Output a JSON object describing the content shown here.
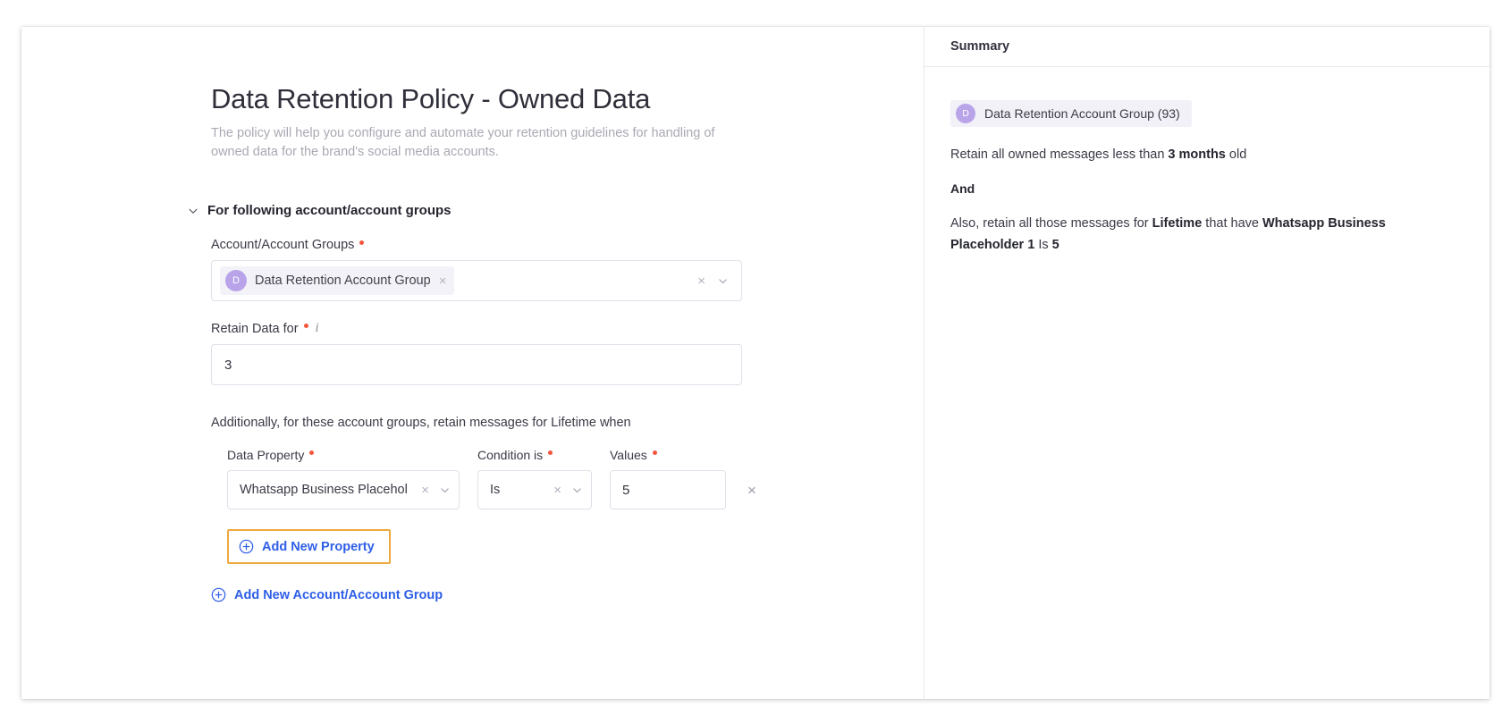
{
  "header": {
    "title": "Data Retention Policy - Owned Data",
    "subtitle": "The policy will help you configure and automate your retention guidelines for handling of owned data for the brand's social media accounts."
  },
  "section": {
    "title": "For following account/account groups",
    "collapse_icon": "chevron-down-icon"
  },
  "account_groups_field": {
    "label": "Account/Account Groups",
    "required_marker": "•",
    "chip": {
      "avatar_initial": "D",
      "avatar_color": "#b9a4ea",
      "text": "Data Retention Account Group",
      "remove_icon": "×"
    },
    "clear_icon": "×",
    "dropdown_icon": "chevron-down-icon"
  },
  "retain_data_field": {
    "label": "Retain Data for",
    "required_marker": "•",
    "info_icon": "i",
    "value": "3",
    "placeholder": "Enter duration"
  },
  "additional_text": "Additionally, for these account groups, retain messages for Lifetime when",
  "property_table": {
    "columns": [
      {
        "label": "Data Property",
        "required_marker": "•"
      },
      {
        "label": "Condition is",
        "required_marker": "•"
      },
      {
        "label": "Values",
        "required_marker": "•"
      }
    ],
    "row": {
      "data_property": "Whatsapp Business Placehol",
      "data_property_clear_icon": "×",
      "data_property_dropdown_icon": "chevron-down-icon",
      "condition": "Is",
      "condition_clear_icon": "×",
      "condition_dropdown_icon": "chevron-down-icon",
      "value": "5",
      "value_placeholder": "Enter value",
      "remove_row_icon": "×"
    }
  },
  "actions": {
    "add_property": {
      "label": "Add New Property",
      "icon": "plus-circle-icon",
      "highlight_color": "#eda93e"
    },
    "add_account_group": {
      "label": "Add New Account/Account Group",
      "icon": "plus-circle-icon"
    },
    "link_color": "#2e5ee8"
  },
  "summary": {
    "title": "Summary",
    "chip": {
      "avatar_initial": "D",
      "text": "Data Retention Account Group (93)"
    },
    "line1_prefix": "Retain all owned messages less than ",
    "line1_bold": "3 months",
    "line1_suffix": " old",
    "connector": "And",
    "line2_prefix": "Also, retain all those messages for ",
    "line2_bold1": "Lifetime",
    "line2_mid": " that have ",
    "line2_bold2": "Whatsapp Business Placeholder 1",
    "line2_mid2": " Is ",
    "line2_bold3": "5"
  }
}
